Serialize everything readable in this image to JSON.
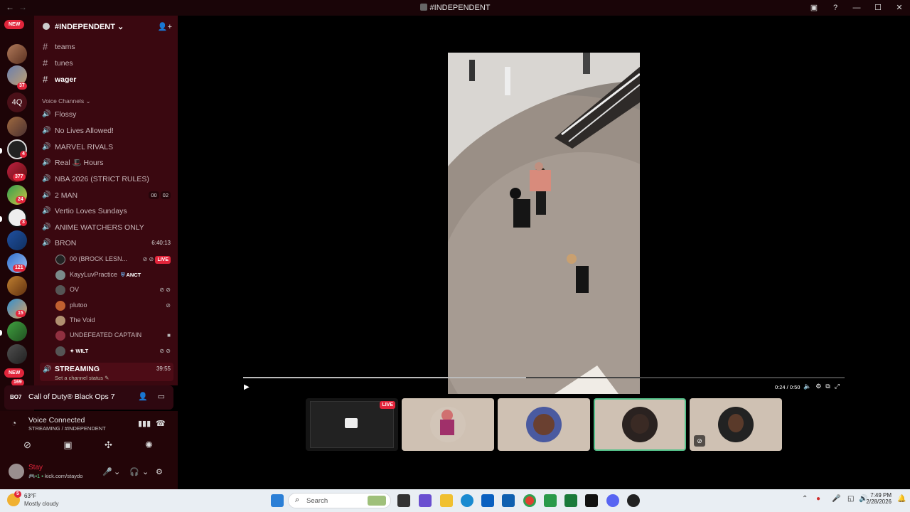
{
  "window": {
    "title": "#INDEPENDENT"
  },
  "guilds": {
    "new_label": "NEW",
    "badges": [
      "37",
      "4",
      "377",
      "24",
      "3",
      "121",
      "15",
      "169"
    ],
    "text_icon": "4Q"
  },
  "server": {
    "name": "#INDEPENDENT"
  },
  "text_channels": [
    "teams",
    "tunes",
    "wager"
  ],
  "voice_category": "Voice Channels",
  "voice_channels": [
    {
      "name": "Flossy"
    },
    {
      "name": "No Lives Allowed!"
    },
    {
      "name": "MARVEL RIVALS"
    },
    {
      "name": "Real 🎩 Hours"
    },
    {
      "name": "NBA 2026 (STRICT RULES)"
    },
    {
      "name": "2 MAN",
      "count_a": "00",
      "count_b": "02"
    },
    {
      "name": "Vertio Loves Sundays"
    },
    {
      "name": "ANIME WATCHERS ONLY"
    },
    {
      "name": "BRON",
      "time": "6:40:13"
    }
  ],
  "bron_users": [
    {
      "name": "00 (BROCK LESN...",
      "live": "LIVE"
    },
    {
      "name": "KayyLuvPractice",
      "tag": "ANCT"
    },
    {
      "name": "OV"
    },
    {
      "name": "plutoo"
    },
    {
      "name": "The Void"
    },
    {
      "name": "UNDEFEATED CAPTAIN"
    },
    {
      "name": "WILT"
    }
  ],
  "streaming": {
    "name": "STREAMING",
    "time": "39:55",
    "status": "Set a channel status"
  },
  "game_activity": {
    "icon_text": "BO7",
    "name": "Call of Duty® Black Ops 7"
  },
  "voice": {
    "title": "Voice Connected",
    "subtitle": "STREAMING / #INDEPENDENT"
  },
  "me": {
    "name": "Stay",
    "status": "kick.com/staydo"
  },
  "player": {
    "time": "0:24 / 0:50",
    "progress": 0.47
  },
  "thumbnails": {
    "live_label": "LIVE"
  },
  "colors": {
    "accent_red": "#e2253b",
    "sidebar": "#3a0810",
    "select_green": "#54c18a"
  },
  "taskbar": {
    "temp": "63°F",
    "weather": "Mostly cloudy",
    "weather_badge": "5",
    "search": "Search",
    "time": "7:49 PM",
    "date": "2/28/2026"
  }
}
